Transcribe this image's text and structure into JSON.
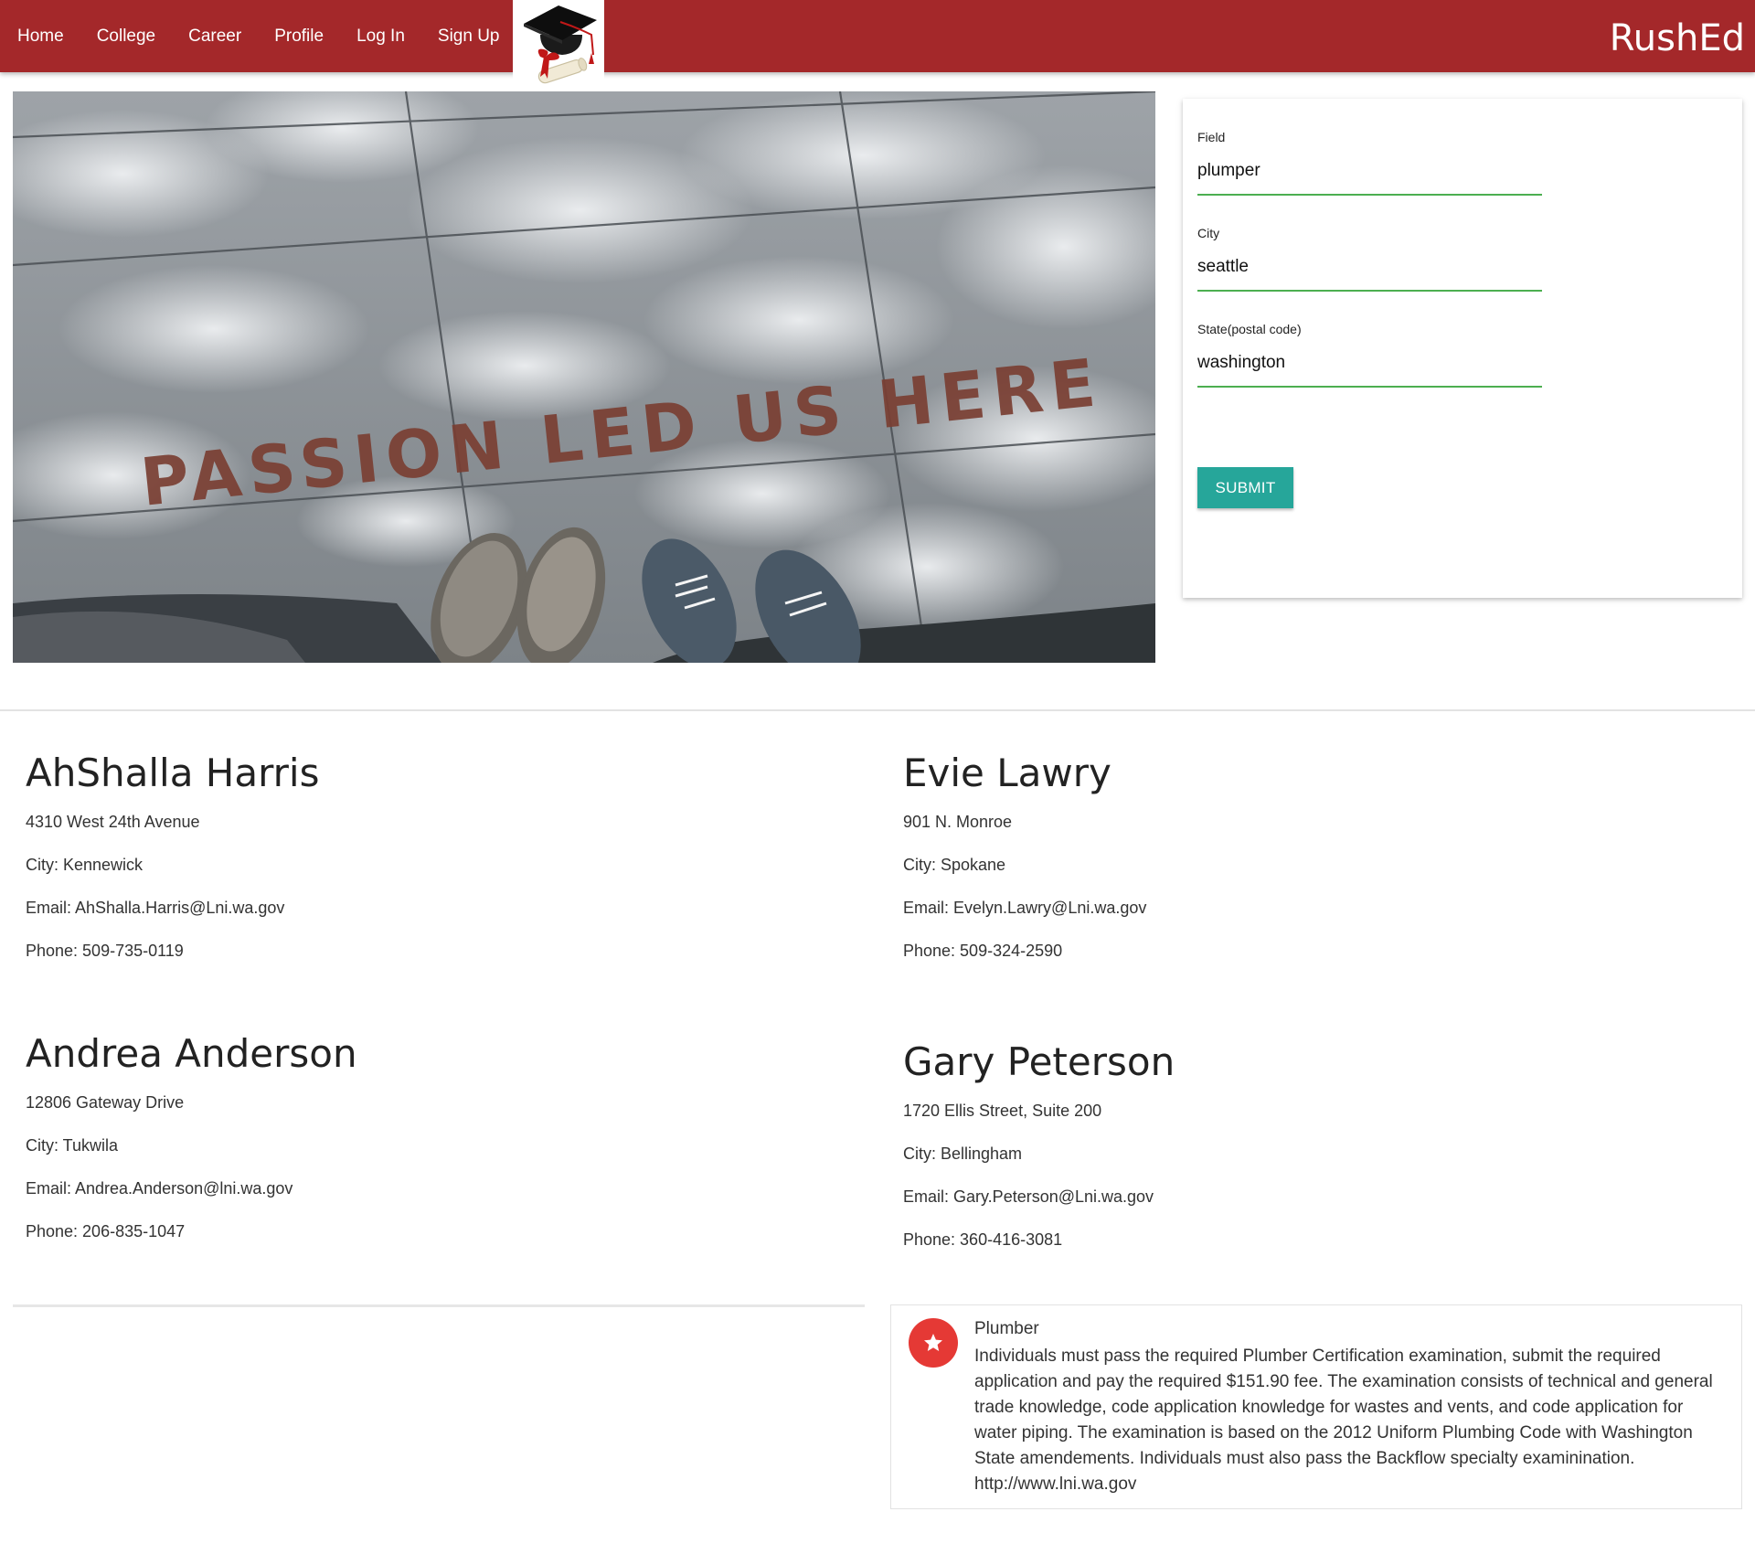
{
  "nav": {
    "links": [
      "Home",
      "College",
      "Career",
      "Profile",
      "Log In",
      "Sign Up"
    ],
    "brand": "RushEd",
    "logo_icon": "graduation-cap-diploma-icon",
    "bar_color": "#a4282a"
  },
  "hero": {
    "text": "PASSION LED US HERE"
  },
  "search": {
    "field_label": "Field",
    "field_value": "plumper",
    "city_label": "City",
    "city_value": "seattle",
    "state_label": "State(postal code)",
    "state_value": "washington",
    "submit_label": "SUBMIT",
    "accent": "#4caf50",
    "button_color": "#26a69a"
  },
  "contacts": [
    {
      "name": "AhShalla Harris",
      "address": "4310 West 24th Avenue",
      "city": "City: Kennewick",
      "email": "Email: AhShalla.Harris@Lni.wa.gov",
      "phone": "Phone: 509-735-0119"
    },
    {
      "name": "Evie Lawry",
      "address": "901 N. Monroe",
      "city": "City: Spokane",
      "email": "Email: Evelyn.Lawry@Lni.wa.gov",
      "phone": "Phone: 509-324-2590"
    },
    {
      "name": "Andrea Anderson",
      "address": "12806 Gateway Drive",
      "city": "City: Tukwila",
      "email": "Email: Andrea.Anderson@lni.wa.gov",
      "phone": "Phone: 206-835-1047"
    },
    {
      "name": "Gary Peterson",
      "address": "1720 Ellis Street, Suite 200",
      "city": "City: Bellingham",
      "email": "Email: Gary.Peterson@Lni.wa.gov",
      "phone": "Phone: 360-416-3081"
    }
  ],
  "info": {
    "icon": "star-icon",
    "icon_color": "#e53935",
    "title": "Plumber",
    "body": "Individuals must pass the required Plumber Certification examination, submit the required application and pay the required $151.90 fee. The examination consists of technical and general trade knowledge, code application knowledge for wastes and vents, and code application for water piping. The examination is based on the 2012 Uniform Plumbing Code with Washington State amendements. Individuals must also pass the Backflow specialty examinination.",
    "link": "http://www.lni.wa.gov"
  }
}
